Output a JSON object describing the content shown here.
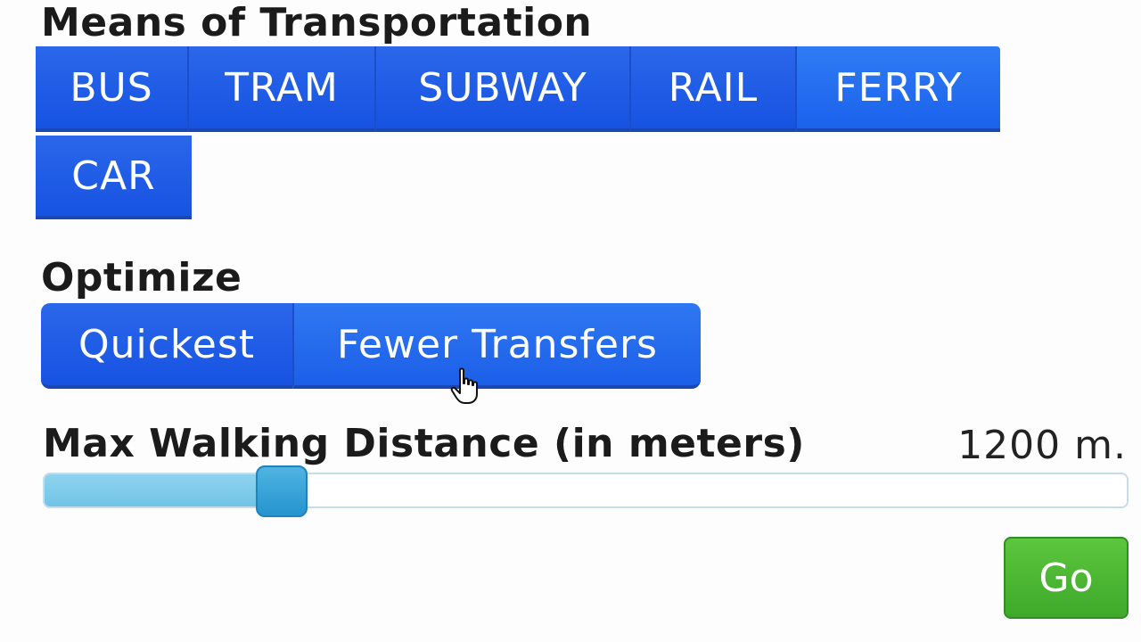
{
  "transport": {
    "heading": "Means of Transportation",
    "modes": [
      {
        "label": "BUS",
        "selected": false
      },
      {
        "label": "TRAM",
        "selected": false
      },
      {
        "label": "SUBWAY",
        "selected": false
      },
      {
        "label": "RAIL",
        "selected": false
      },
      {
        "label": "FERRY",
        "selected": true
      },
      {
        "label": "CAR",
        "selected": false
      }
    ]
  },
  "optimize": {
    "heading": "Optimize",
    "options": [
      {
        "label": "Quickest",
        "selected": false
      },
      {
        "label": "Fewer Transfers",
        "selected": true
      }
    ]
  },
  "walking": {
    "heading": "Max Walking Distance (in meters)",
    "value_label": "1200 m.",
    "slider_fraction": 0.21
  },
  "go_label": "Go",
  "colors": {
    "button_blue": "#1e5ae6",
    "slider_fill": "#7fcbeb",
    "slider_handle": "#2f9fd8",
    "go_green": "#4bb534"
  },
  "icons": {
    "cursor": "hand-pointer-icon"
  }
}
